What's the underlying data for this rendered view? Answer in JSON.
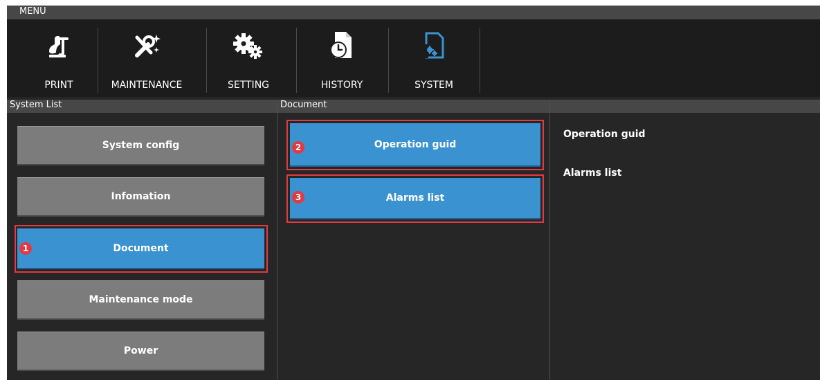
{
  "menu": {
    "title": "MENU"
  },
  "toolbar": {
    "items": [
      {
        "label": "PRINT",
        "icon": "print-icon"
      },
      {
        "label": "MAINTENANCE",
        "icon": "maintenance-icon"
      },
      {
        "label": "SETTING",
        "icon": "setting-icon"
      },
      {
        "label": "HISTORY",
        "icon": "history-icon"
      },
      {
        "label": "SYSTEM",
        "icon": "system-icon",
        "active": true
      }
    ]
  },
  "system_list": {
    "header": "System List",
    "buttons": [
      {
        "label": "System config"
      },
      {
        "label": "Infomation"
      },
      {
        "label": "Document",
        "selected": true,
        "callout": "1"
      },
      {
        "label": "Maintenance mode"
      },
      {
        "label": "Power"
      }
    ]
  },
  "document": {
    "header": "Document",
    "buttons": [
      {
        "label": "Operation guid",
        "callout": "2"
      },
      {
        "label": "Alarms list",
        "callout": "3"
      }
    ]
  },
  "detail": {
    "items": [
      "Operation guid",
      "Alarms list"
    ]
  },
  "colors": {
    "accent": "#3a92d1",
    "callout": "#e23a43",
    "button": "#7c7c7c",
    "background": "#262626"
  }
}
